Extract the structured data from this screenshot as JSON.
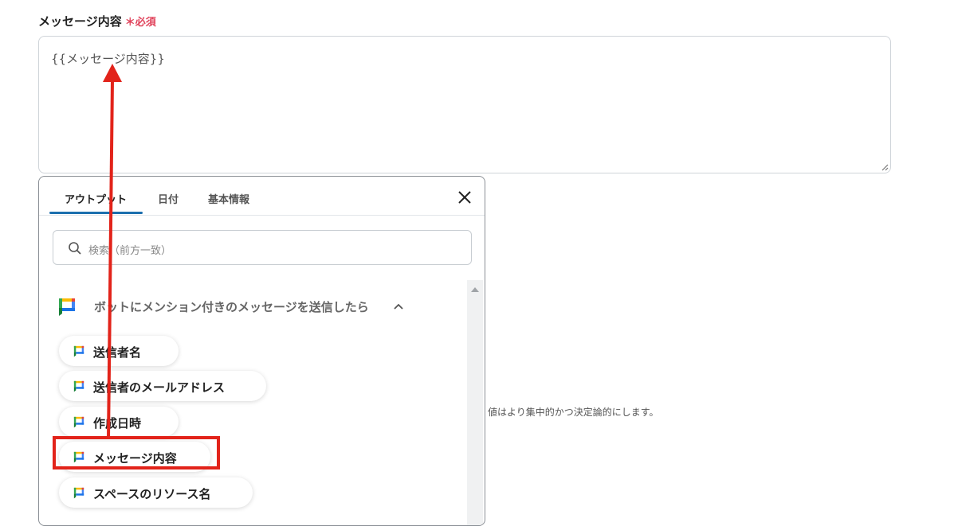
{
  "field": {
    "label": "メッセージ内容",
    "required_mark": "＊",
    "required_text": "必須",
    "value": "{{メッセージ内容}}"
  },
  "background_hint": "値はより集中的かつ決定論的にします。",
  "panel": {
    "tabs": [
      {
        "label": "アウトプット",
        "active": true
      },
      {
        "label": "日付",
        "active": false
      },
      {
        "label": "基本情報",
        "active": false
      }
    ],
    "search_placeholder": "検索（前方一致）",
    "section": {
      "title": "ボットにメンション付きのメッセージを送信したら",
      "expanded": true,
      "icon": "google-chat-icon"
    },
    "items": [
      {
        "label": "送信者名"
      },
      {
        "label": "送信者のメールアドレス"
      },
      {
        "label": "作成日時"
      },
      {
        "label": "メッセージ内容",
        "highlighted": true
      },
      {
        "label": "スペースのリソース名"
      }
    ]
  },
  "colors": {
    "accent_tab": "#1c6fae",
    "required": "#e0435b",
    "annotation": "#e2231a"
  }
}
